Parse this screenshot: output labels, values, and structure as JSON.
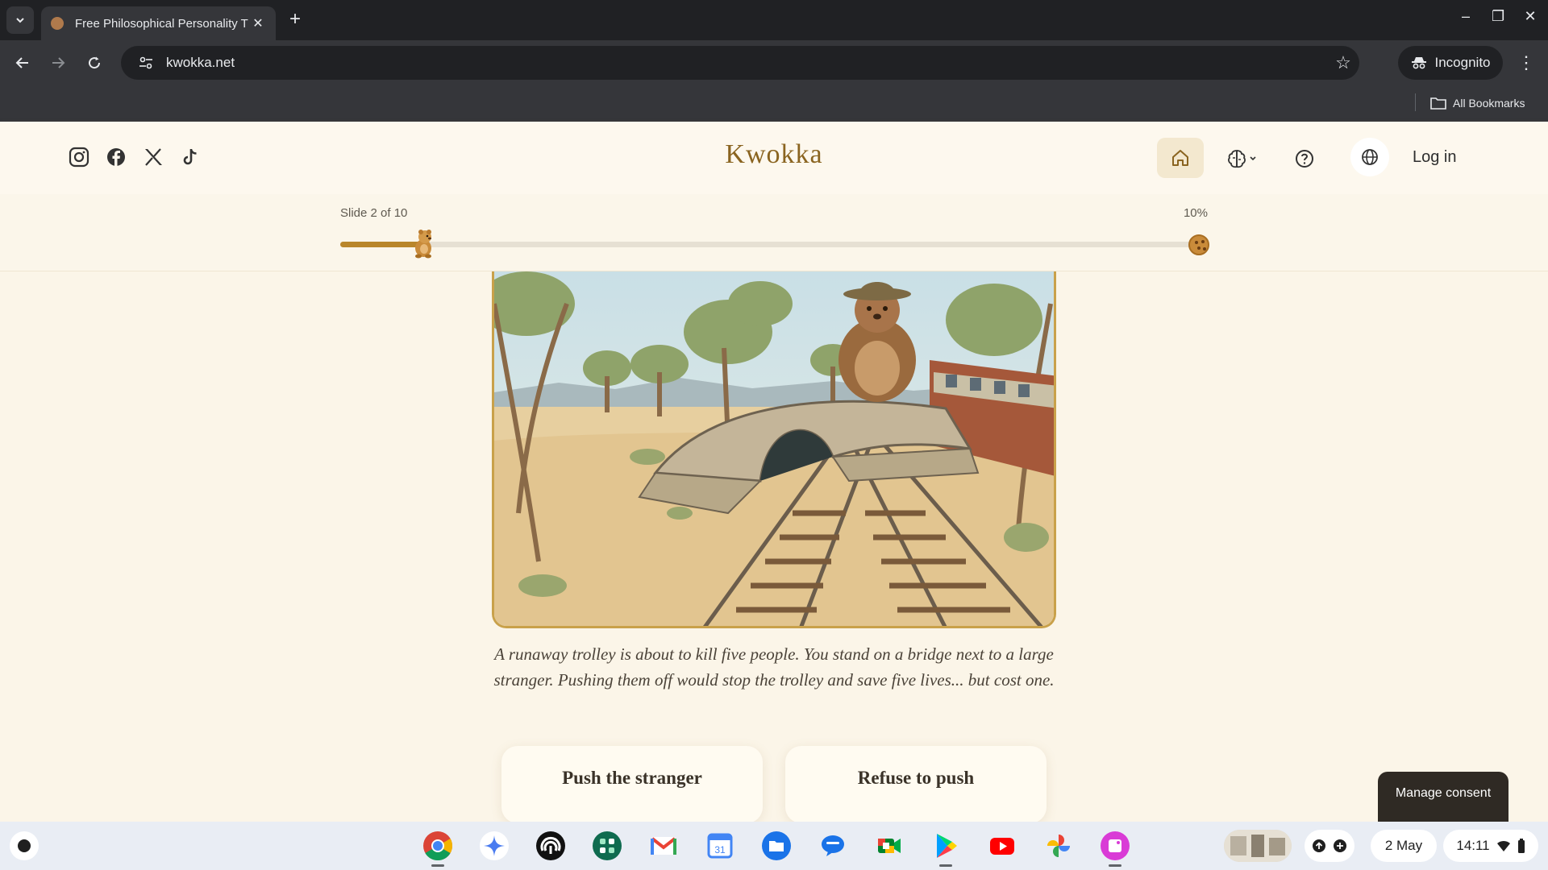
{
  "browser": {
    "tab_title": "Free Philosophical Personality T",
    "url": "kwokka.net",
    "incognito_label": "Incognito",
    "bookmarks_label": "All Bookmarks"
  },
  "site": {
    "brand": "Kwokka",
    "login_label": "Log in",
    "social_icons": [
      "instagram-icon",
      "facebook-icon",
      "x-icon",
      "tiktok-icon"
    ],
    "accent_color": "#b9862b"
  },
  "progress": {
    "slide_label": "Slide 2 of 10",
    "percent_label": "10%",
    "fraction": 0.1
  },
  "scenario": {
    "question": "A runaway trolley is about to kill five people. You stand on a bridge next to a large stranger. Pushing them off would stop the trolley and save five lives... but cost one.",
    "choices": [
      "Push the stranger",
      "Refuse to push"
    ]
  },
  "consent": {
    "label": "Manage consent"
  },
  "shelf": {
    "apps": [
      "chrome-icon",
      "gemini-icon",
      "podcast-icon",
      "apps-icon",
      "gmail-icon",
      "calendar-icon",
      "files-icon",
      "messages-icon",
      "meet-icon",
      "play-store-icon",
      "youtube-icon",
      "photos-icon",
      "screencast-icon"
    ],
    "calendar_day": "31",
    "date": "2 May",
    "time": "14:11"
  }
}
